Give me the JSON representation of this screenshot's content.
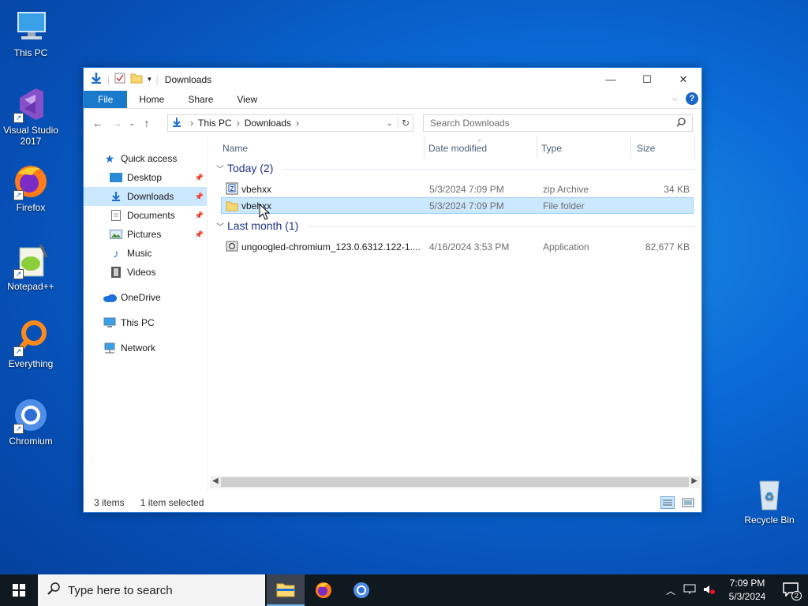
{
  "desktop": {
    "icons": [
      {
        "label": "This PC"
      },
      {
        "label": "Visual Studio\n2017"
      },
      {
        "label": "Firefox"
      },
      {
        "label": "Notepad++"
      },
      {
        "label": "Everything"
      },
      {
        "label": "Chromium"
      },
      {
        "label": "Recycle Bin"
      }
    ]
  },
  "window": {
    "title": "Downloads",
    "ribbon_tabs": [
      "File",
      "Home",
      "Share",
      "View"
    ],
    "address": {
      "segments": [
        "This PC",
        "Downloads"
      ]
    },
    "search_placeholder": "Search Downloads",
    "nav": [
      {
        "label": "Quick access"
      },
      {
        "label": "Desktop"
      },
      {
        "label": "Downloads"
      },
      {
        "label": "Documents"
      },
      {
        "label": "Pictures"
      },
      {
        "label": "Music"
      },
      {
        "label": "Videos"
      },
      {
        "label": "OneDrive"
      },
      {
        "label": "This PC"
      },
      {
        "label": "Network"
      }
    ],
    "columns": [
      "Name",
      "Date modified",
      "Type",
      "Size"
    ],
    "groups": [
      {
        "title": "Today (2)",
        "files": [
          {
            "name": "vbehxx",
            "date": "5/3/2024 7:09 PM",
            "type": "zip Archive",
            "size": "34 KB"
          },
          {
            "name": "vbehxx",
            "date": "5/3/2024 7:09 PM",
            "type": "File folder",
            "size": ""
          }
        ]
      },
      {
        "title": "Last month (1)",
        "files": [
          {
            "name": "ungoogled-chromium_123.0.6312.122-1....",
            "date": "4/16/2024 3:53 PM",
            "type": "Application",
            "size": "82,677 KB"
          }
        ]
      }
    ],
    "status": {
      "items": "3 items",
      "selected": "1 item selected"
    }
  },
  "taskbar": {
    "search_placeholder": "Type here to search",
    "time": "7:09 PM",
    "date": "5/3/2024",
    "notifications": "2"
  },
  "colors": {
    "accent": "#1979ca",
    "selection": "#cce8ff",
    "folder": "#f8d775"
  }
}
